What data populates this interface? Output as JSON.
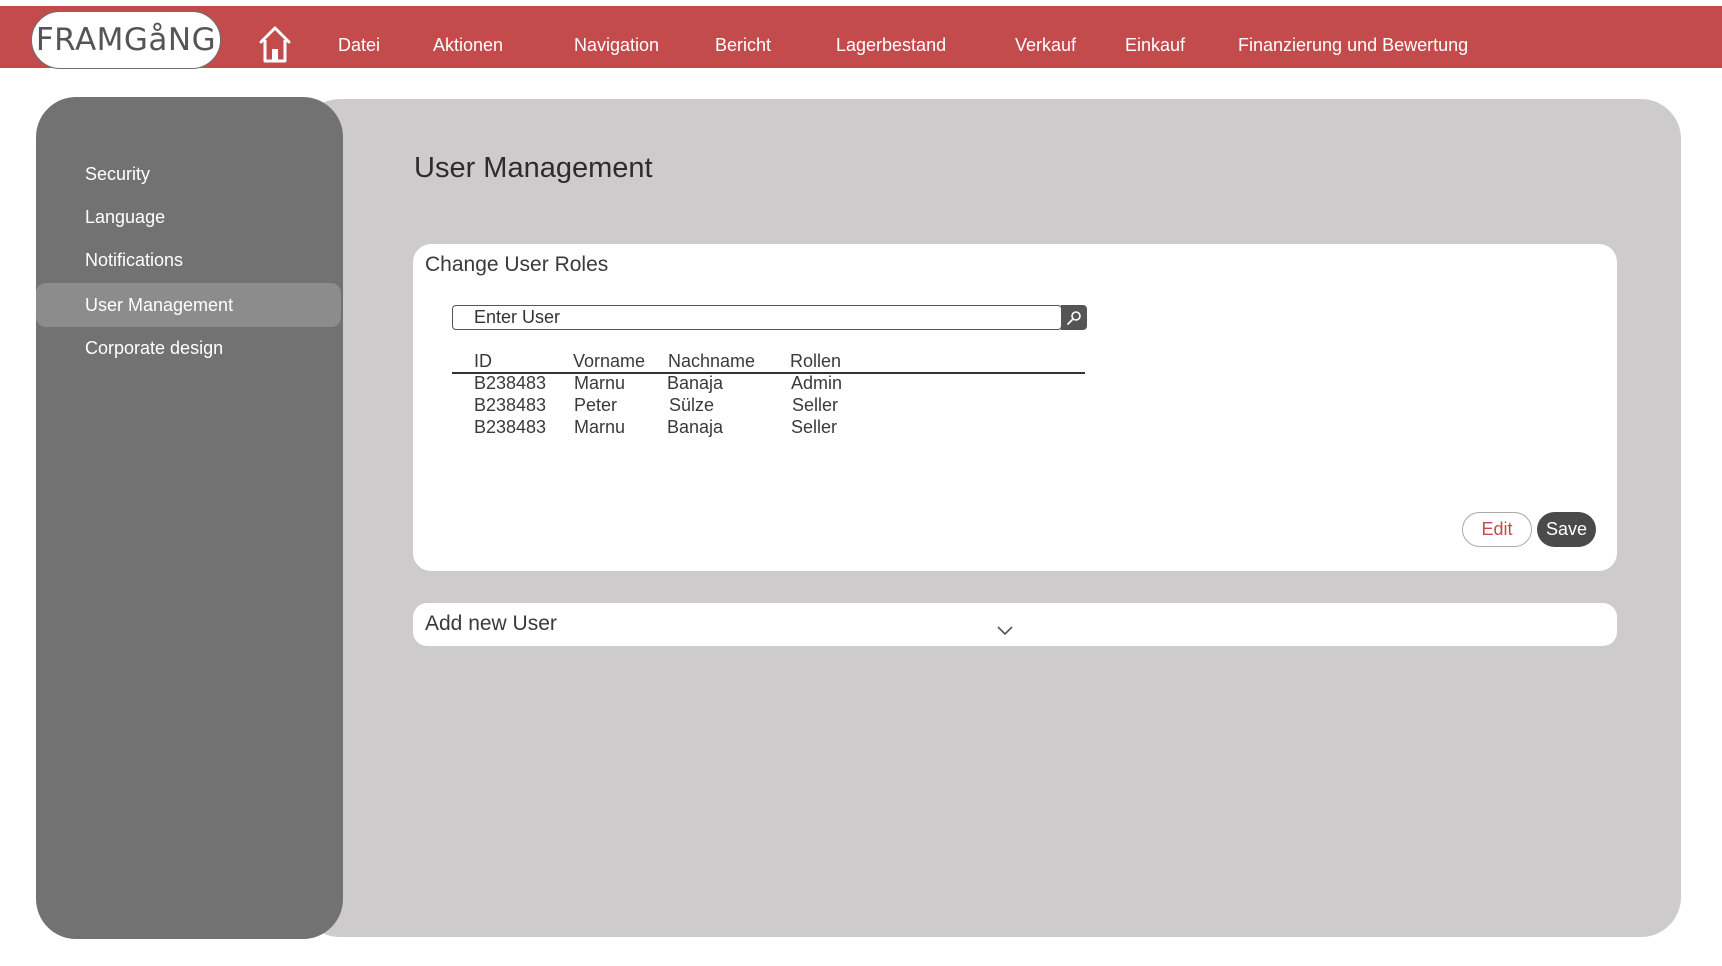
{
  "brand": {
    "logo_text": "FRAMGåNG"
  },
  "nav": {
    "items": [
      "Datei",
      "Aktionen",
      "Navigation",
      "Bericht",
      "Lagerbestand",
      "Verkauf",
      "Einkauf",
      "Finanzierung und Bewertung"
    ]
  },
  "sidebar": {
    "items": [
      {
        "label": "Security"
      },
      {
        "label": "Language"
      },
      {
        "label": "Notifications"
      },
      {
        "label": "User Management",
        "active": true
      },
      {
        "label": "Corporate design"
      }
    ]
  },
  "main": {
    "title": "User Management",
    "roles_card": {
      "title": "Change User Roles",
      "search": {
        "placeholder": "Enter User",
        "value": ""
      },
      "table": {
        "headers": [
          "ID",
          "Vorname",
          "Nachname",
          "Rollen"
        ],
        "rows": [
          [
            "B238483",
            "Marnu",
            "Banaja",
            "Admin"
          ],
          [
            "B238483",
            "Peter",
            "Sülze",
            "Seller"
          ],
          [
            "B238483",
            "Marnu",
            "Banaja",
            "Seller"
          ]
        ]
      },
      "edit_label": "Edit",
      "save_label": "Save"
    },
    "add_user": {
      "title": "Add new User"
    }
  },
  "colors": {
    "topbar": "#c34b4c",
    "sidebar": "#727272",
    "sidebar_active": "#8c8c8c",
    "panel": "#cdcbcc",
    "save_button": "#4a4a4a"
  },
  "icons": [
    "home-icon",
    "search-icon",
    "chevron-down-icon"
  ]
}
